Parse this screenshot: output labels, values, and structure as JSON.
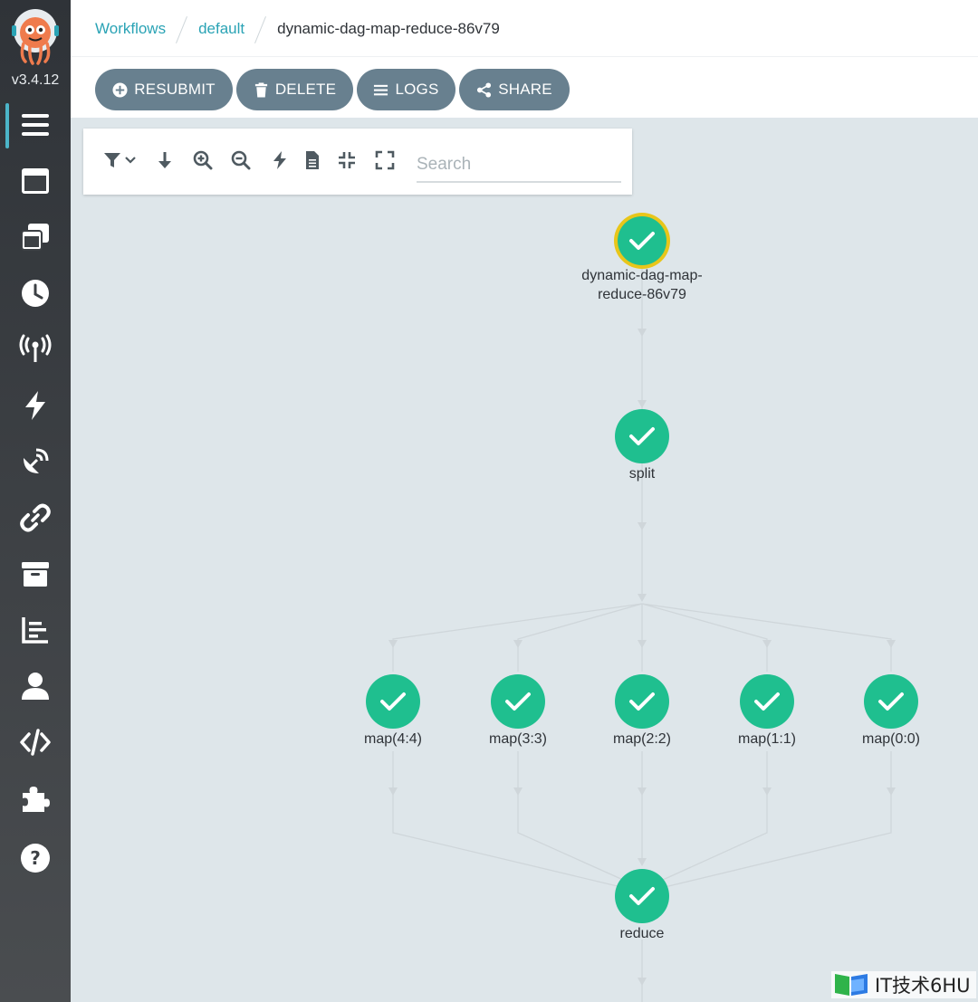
{
  "app": {
    "version": "v3.4.12"
  },
  "sidebar": {
    "items": [
      {
        "icon": "hamburger-icon",
        "name": "workflows"
      },
      {
        "icon": "window-icon",
        "name": "workflow-templates"
      },
      {
        "icon": "clone-icon",
        "name": "cluster-workflow-templates"
      },
      {
        "icon": "clock-icon",
        "name": "cron-workflows"
      },
      {
        "icon": "broadcast-icon",
        "name": "event-sources"
      },
      {
        "icon": "bolt-icon",
        "name": "sensors"
      },
      {
        "icon": "satellite-dish-icon",
        "name": "event-flow"
      },
      {
        "icon": "link-icon",
        "name": "event-bindings"
      },
      {
        "icon": "archive-icon",
        "name": "archived-workflows"
      },
      {
        "icon": "report-icon",
        "name": "reports"
      },
      {
        "icon": "user-icon",
        "name": "user"
      },
      {
        "icon": "code-icon",
        "name": "api-docs"
      },
      {
        "icon": "puzzle-icon",
        "name": "plugins"
      },
      {
        "icon": "help-icon",
        "name": "help"
      }
    ]
  },
  "breadcrumb": {
    "items": [
      "Workflows",
      "default"
    ],
    "current": "dynamic-dag-map-reduce-86v79"
  },
  "actions": {
    "resubmit": "RESUBMIT",
    "delete": "DELETE",
    "logs": "LOGS",
    "share": "SHARE"
  },
  "graph_toolbar": {
    "search_placeholder": "Search"
  },
  "graph": {
    "nodes": {
      "root": "dynamic-dag-map-reduce-86v79",
      "root_line1": "dynamic-dag-map-",
      "root_line2": "reduce-86v79",
      "split": "split",
      "map_4": "map(4:4)",
      "map_3": "map(3:3)",
      "map_2": "map(2:2)",
      "map_1": "map(1:1)",
      "map_0": "map(0:0)",
      "reduce": "reduce"
    },
    "status": "succeeded"
  },
  "watermark": {
    "text": "IT技术6HU"
  },
  "colors": {
    "accent": "#2aa3b5",
    "button": "#68808f",
    "success_node": "#1fbf8f",
    "selected_ring": "#e8c61a",
    "canvas": "#dee6ea"
  }
}
